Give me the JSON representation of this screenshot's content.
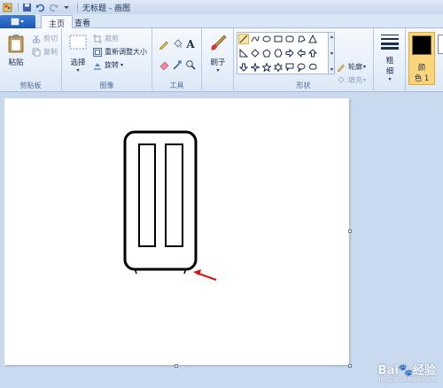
{
  "window": {
    "title": "无标题 - 画图"
  },
  "tabs": {
    "file_label": "▾",
    "home": "主页",
    "view": "查看"
  },
  "clipboard": {
    "paste": "粘贴",
    "cut": "剪切",
    "copy": "复制",
    "group_label": "剪贴板"
  },
  "image": {
    "select": "选择",
    "crop": "裁剪",
    "resize": "重新调整大小",
    "rotate": "旋转",
    "group_label": "图像"
  },
  "tools": {
    "group_label": "工具",
    "text_glyph": "A"
  },
  "brushes": {
    "label": "刷子"
  },
  "shapes": {
    "outline": "轮廓",
    "fill": "填充",
    "group_label": "形状"
  },
  "size": {
    "label_line1": "粗",
    "label_line2": "细"
  },
  "color1": {
    "label_line1": "颜",
    "label_line2": "色 1",
    "value": "#000000"
  },
  "colors": {
    "accent": "#1c58b4",
    "annotation_arrow": "#d01818"
  },
  "watermark": {
    "brand": "Bai",
    "brand_suffix": "经验",
    "url": "jingyan.baidu.com"
  }
}
